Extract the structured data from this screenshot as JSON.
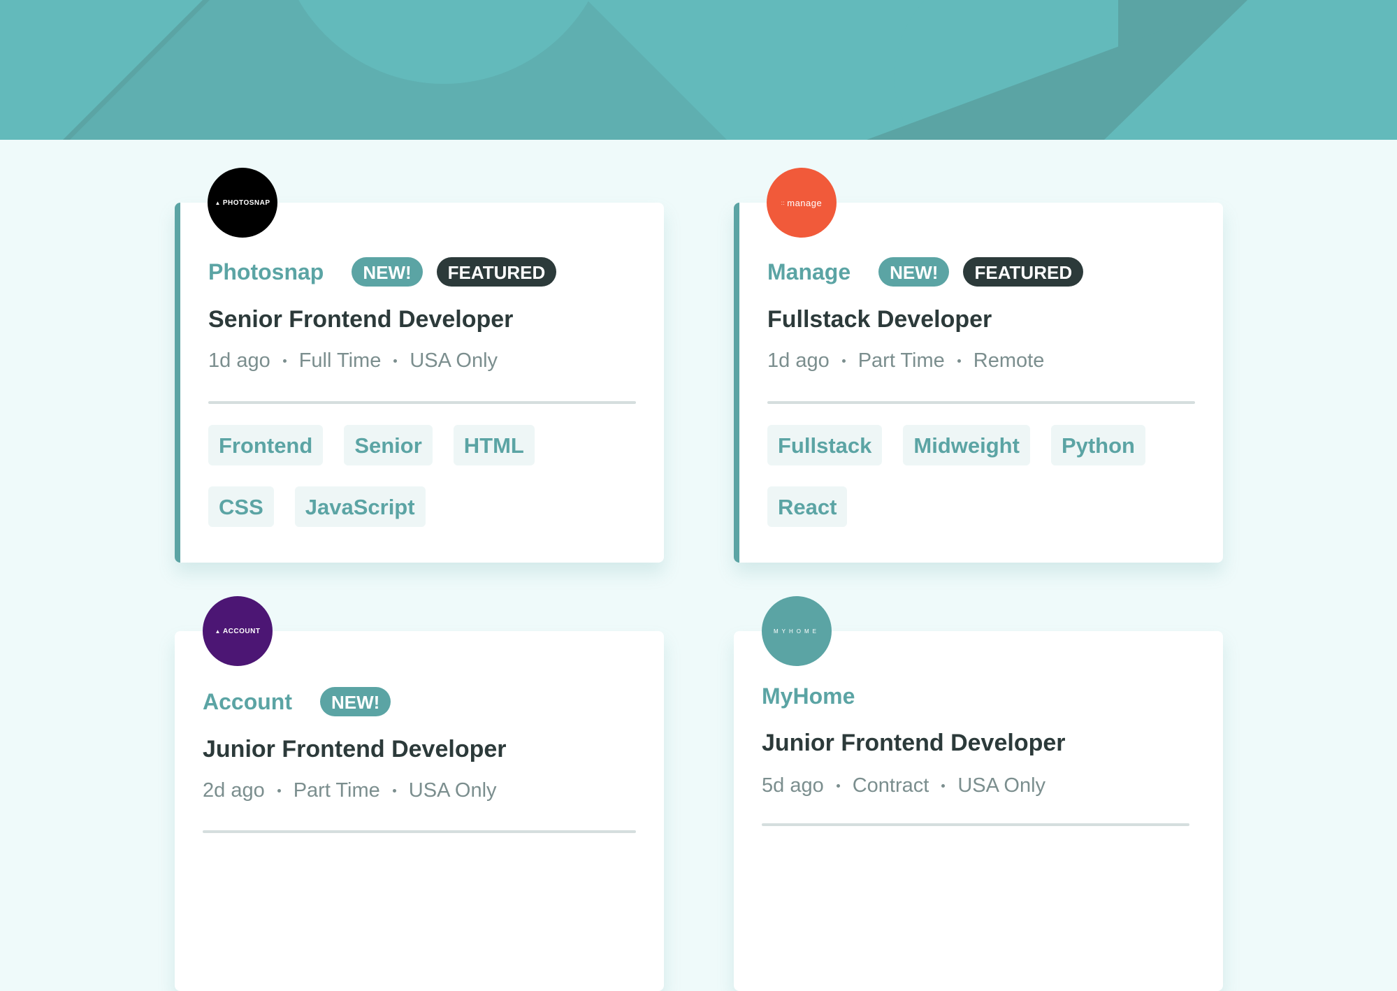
{
  "colors": {
    "primary": "#5ba4a4",
    "dark": "#2c3a3a",
    "muted": "#7b8e8e",
    "background": "#effafa",
    "tag_bg": "#eef6f6"
  },
  "jobs": [
    {
      "company": "Photosnap",
      "logo_text": "PHOTOSNAP",
      "logo_color": "#000000",
      "new": "NEW!",
      "featured": "FEATURED",
      "position": "Senior Frontend Developer",
      "posted": "1d ago",
      "contract": "Full Time",
      "location": "USA Only",
      "tags": [
        "Frontend",
        "Senior",
        "HTML",
        "CSS",
        "JavaScript"
      ]
    },
    {
      "company": "Manage",
      "logo_text": "manage",
      "logo_color": "#f15a3a",
      "new": "NEW!",
      "featured": "FEATURED",
      "position": "Fullstack Developer",
      "posted": "1d ago",
      "contract": "Part Time",
      "location": "Remote",
      "tags": [
        "Fullstack",
        "Midweight",
        "Python",
        "React"
      ]
    },
    {
      "company": "Account",
      "logo_text": "ACCOUNT",
      "logo_color": "#4c1674",
      "new": "NEW!",
      "position": "Junior Frontend Developer",
      "posted": "2d ago",
      "contract": "Part Time",
      "location": "USA Only"
    },
    {
      "company": "MyHome",
      "logo_text": "MYHOME",
      "logo_color": "#5ba4a4",
      "position": "Junior Frontend Developer",
      "posted": "5d ago",
      "contract": "Contract",
      "location": "USA Only"
    }
  ]
}
